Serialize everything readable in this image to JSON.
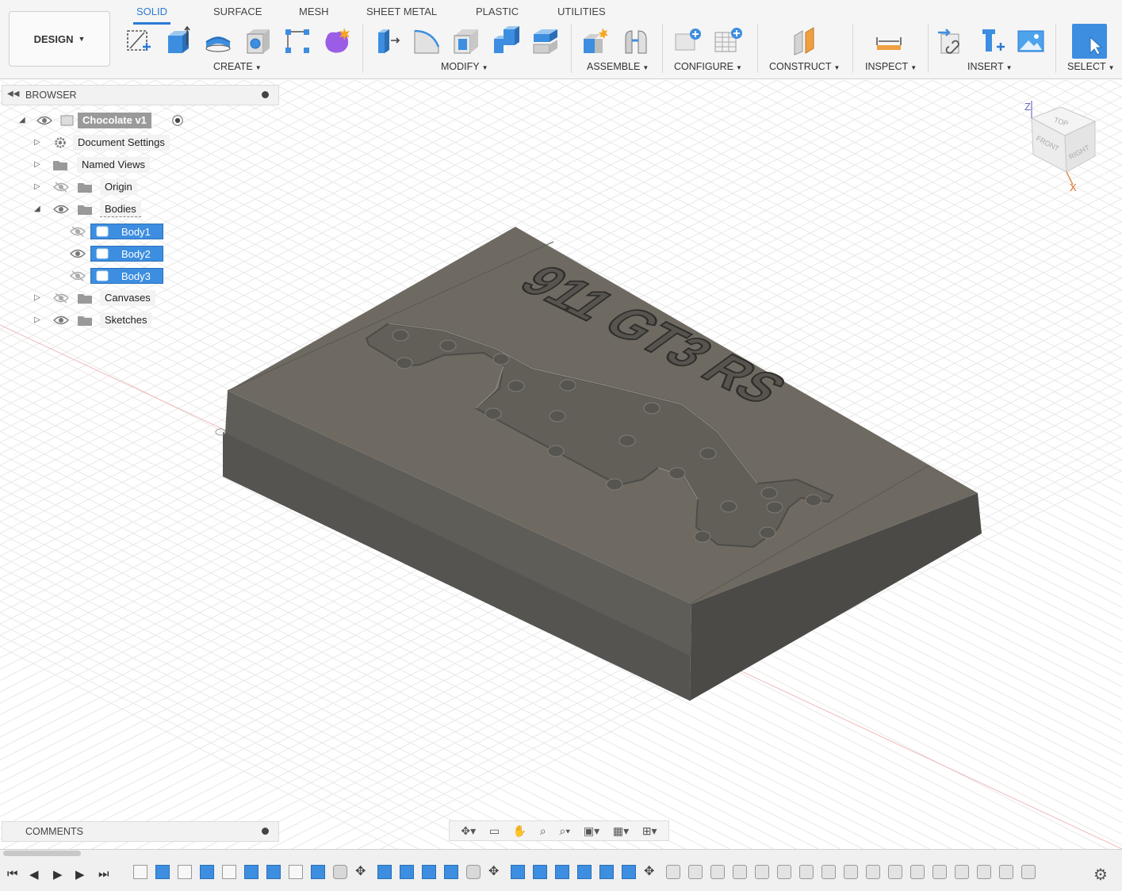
{
  "workspace": {
    "label": "DESIGN"
  },
  "tabs": [
    {
      "label": "SOLID",
      "active": true
    },
    {
      "label": "SURFACE"
    },
    {
      "label": "MESH"
    },
    {
      "label": "SHEET METAL"
    },
    {
      "label": "PLASTIC"
    },
    {
      "label": "UTILITIES"
    }
  ],
  "groups": {
    "create": "CREATE",
    "modify": "MODIFY",
    "assemble": "ASSEMBLE",
    "configure": "CONFIGURE",
    "construct": "CONSTRUCT",
    "inspect": "INSPECT",
    "insert": "INSERT",
    "select": "SELECT"
  },
  "browser": {
    "title": "BROWSER",
    "root": "Chocolate v1",
    "items": {
      "document_settings": "Document Settings",
      "named_views": "Named Views",
      "origin": "Origin",
      "bodies": "Bodies",
      "body1": "Body1",
      "body2": "Body2",
      "body3": "Body3",
      "canvases": "Canvases",
      "sketches": "Sketches"
    }
  },
  "viewcube": {
    "top": "TOP",
    "front": "FRONT",
    "right": "RIGHT",
    "z_axis": "Z",
    "x_axis": "X"
  },
  "model": {
    "engraved_text": "911 GT3 RS"
  },
  "comments": {
    "title": "COMMENTS"
  },
  "colors": {
    "accent": "#2a7ad6",
    "selection": "#3d8ee0",
    "model_top": "#6e6a62",
    "model_front": "#5a5852",
    "model_side": "#4a4843"
  }
}
